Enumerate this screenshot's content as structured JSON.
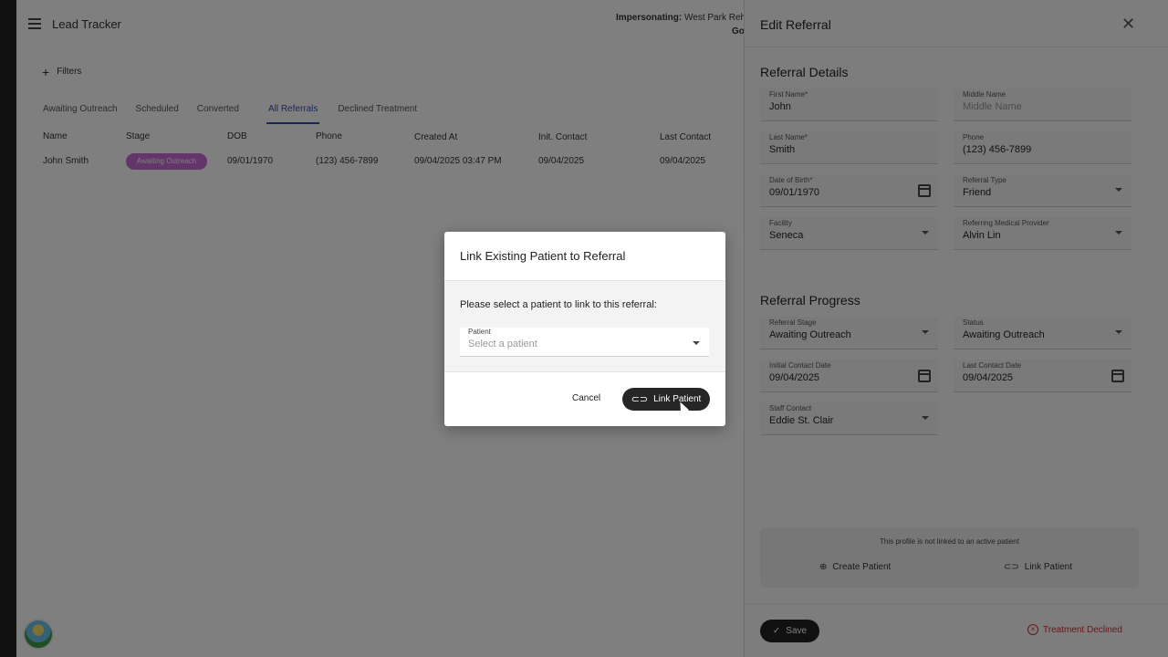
{
  "app": {
    "title": "Lead Tracker",
    "impersonating_label": "Impersonating:",
    "impersonating_value": "West Park Reh",
    "impersonating_sub": "Go"
  },
  "filters": {
    "label": "Filters",
    "icon": "plus-icon"
  },
  "tabs": [
    {
      "label": "Awaiting Outreach",
      "active": false
    },
    {
      "label": "Scheduled",
      "active": false
    },
    {
      "label": "Converted",
      "active": false
    },
    {
      "label": "All Referrals",
      "active": true
    },
    {
      "label": "Declined Treatment",
      "active": false
    }
  ],
  "table": {
    "columns": [
      "Name",
      "Stage",
      "DOB",
      "Phone",
      "Created At",
      "Init. Contact",
      "Last Contact"
    ],
    "rows": [
      {
        "name": "John Smith",
        "stage": "Awaiting Outreach",
        "dob": "09/01/1970",
        "phone": "(123) 456-7899",
        "created_at": "09/04/2025 03:47 PM",
        "init_contact": "09/04/2025",
        "last_contact": "09/04/2025"
      }
    ]
  },
  "panel": {
    "title": "Edit Referral",
    "referral_details_title": "Referral Details",
    "fields": {
      "first_name": {
        "label": "First Name*",
        "value": "John"
      },
      "middle_name": {
        "label": "Middle Name",
        "placeholder": "Middle Name"
      },
      "last_name": {
        "label": "Last Name*",
        "value": "Smith"
      },
      "phone": {
        "label": "Phone",
        "value": "(123) 456-7899"
      },
      "dob": {
        "label": "Date of Birth*",
        "value": "09/01/1970"
      },
      "referral_type": {
        "label": "Referral Type",
        "value": "Friend"
      },
      "facility": {
        "label": "Facility",
        "value": "Seneca"
      },
      "provider": {
        "label": "Referring Medical Provider",
        "value": "Alvin Lin"
      }
    },
    "progress_title": "Referral Progress",
    "progress": {
      "stage": {
        "label": "Referral Stage",
        "value": "Awaiting Outreach"
      },
      "status": {
        "label": "Status",
        "value": "Awaiting Outreach"
      },
      "initial_contact": {
        "label": "Initial Contact Date",
        "value": "09/04/2025"
      },
      "last_contact": {
        "label": "Last Contact Date",
        "value": "09/04/2025"
      },
      "staff_contact": {
        "label": "Staff Contact",
        "value": "Eddie St. Clair"
      }
    },
    "link_box": {
      "message": "This profile is not linked to an active patient",
      "create_label": "Create Patient",
      "link_label": "Link Patient"
    },
    "save_label": "Save",
    "declined_label": "Treatment Declined"
  },
  "dialog": {
    "title": "Link Existing Patient to Referral",
    "prompt": "Please select a patient to link to this referral:",
    "select_label": "Patient",
    "select_placeholder": "Select a patient",
    "cancel_label": "Cancel",
    "link_label": "Link Patient"
  },
  "colors": {
    "accent": "#2f4fb8",
    "stage_pill": "#c66ad4",
    "danger": "#d32f2f",
    "dark_button": "#262626"
  }
}
